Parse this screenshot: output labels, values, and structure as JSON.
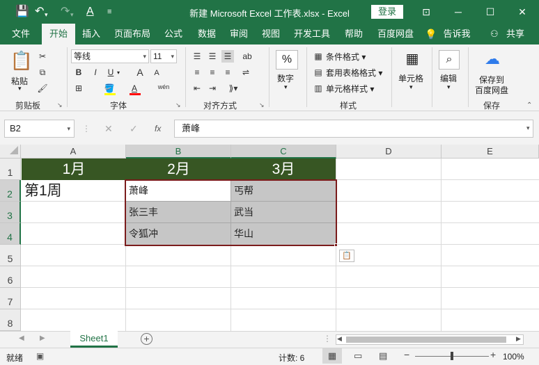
{
  "titlebar": {
    "title": "新建 Microsoft Excel 工作表.xlsx  -  Excel",
    "login": "登录"
  },
  "tabs": [
    "文件",
    "开始",
    "插入",
    "页面布局",
    "公式",
    "数据",
    "审阅",
    "视图",
    "开发工具",
    "帮助",
    "百度网盘",
    "告诉我",
    "共享"
  ],
  "ribbon": {
    "clipboard": {
      "paste": "粘贴",
      "group": "剪贴板"
    },
    "font": {
      "name": "等线",
      "size": "11",
      "bold": "B",
      "italic": "I",
      "underline": "U",
      "grow": "A",
      "shrink": "A",
      "color_a": "A",
      "wen": "wén",
      "group": "字体"
    },
    "alignment": {
      "group": "对齐方式"
    },
    "number": {
      "label": "数字",
      "percent": "%"
    },
    "styles": {
      "cond": "条件格式",
      "table": "套用表格格式",
      "cell": "单元格样式",
      "group": "样式"
    },
    "cells": {
      "label": "单元格"
    },
    "editing": {
      "label": "编辑"
    },
    "save": {
      "line1": "保存到",
      "line2": "百度网盘",
      "group": "保存"
    }
  },
  "formula_bar": {
    "name_box": "B2",
    "fx": "fx",
    "value": "萧峰"
  },
  "grid": {
    "columns": [
      "A",
      "B",
      "C",
      "D",
      "E"
    ],
    "rows": [
      "1",
      "2",
      "3",
      "4",
      "5",
      "6",
      "7",
      "8"
    ],
    "headers": [
      "1月",
      "2月",
      "3月"
    ],
    "a2": "第1周",
    "b": [
      "萧峰",
      "张三丰",
      "令狐冲"
    ],
    "c": [
      "丐帮",
      "武当",
      "华山"
    ]
  },
  "sheets": {
    "active": "Sheet1",
    "add": "+"
  },
  "status": {
    "ready": "就绪",
    "count": "计数: 6",
    "zoom": "100%"
  },
  "colors": {
    "excel_green": "#217346",
    "header_fill": "#375623",
    "selection_border": "#7b1c1c"
  }
}
